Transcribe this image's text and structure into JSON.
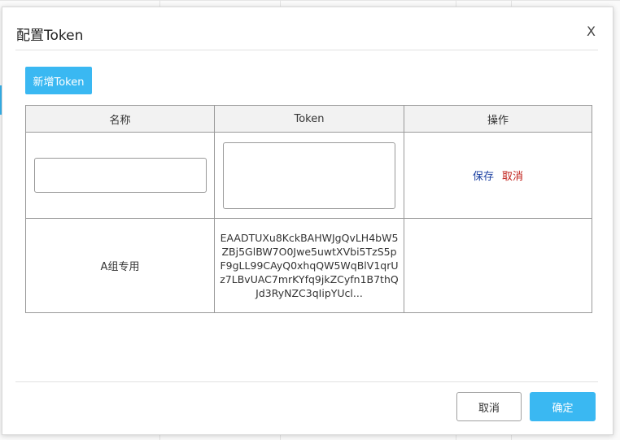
{
  "dialog": {
    "title": "配置Token",
    "close_label": "X",
    "add_button_label": "新增Token"
  },
  "table": {
    "headers": [
      "名称",
      "Token",
      "操作"
    ],
    "edit_row": {
      "name_value": "",
      "token_value": "",
      "save_label": "保存",
      "cancel_label": "取消"
    },
    "rows": [
      {
        "name": "A组专用",
        "token": "EAADTUXu8KckBAHWJgQvLH4bW5ZBj5GlBW7O0Jwe5uwtXVbi5TzS5pF9gLL99CAyQ0xhqQW5WqBlV1qrUz7LBvUAC7mrKYfq9jkZCyfn1B7thQJd3RyNZC3qIipYUcl...",
        "actions": ""
      }
    ]
  },
  "footer": {
    "cancel_label": "取消",
    "ok_label": "确定"
  },
  "colors": {
    "primary": "#3ab8f2",
    "save_link": "#1a3fa0",
    "cancel_link": "#c0201a"
  }
}
